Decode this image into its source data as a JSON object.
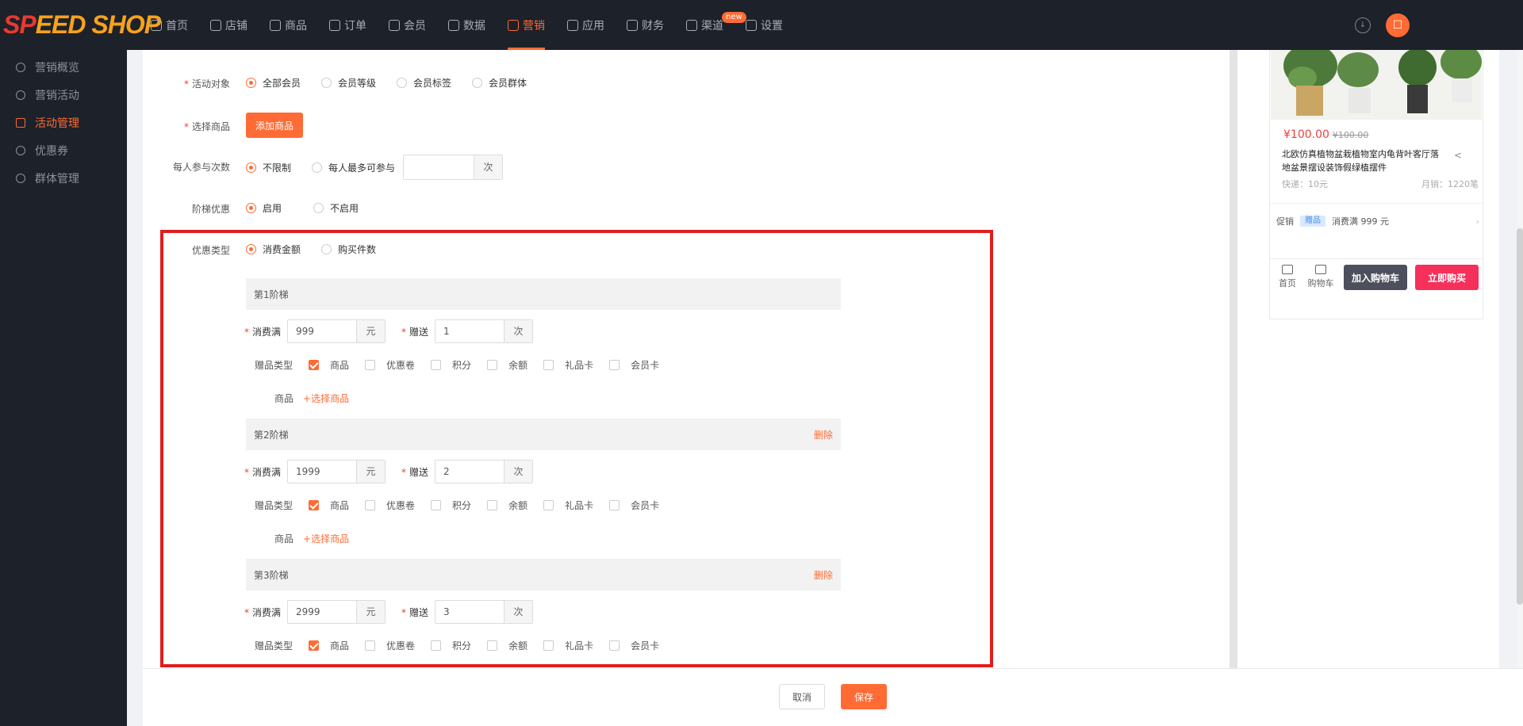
{
  "logo": {
    "part1": "SP",
    "part2": "EED SHOP"
  },
  "nav": [
    {
      "label": "首页",
      "icon": "home-icon"
    },
    {
      "label": "店铺",
      "icon": "store-icon"
    },
    {
      "label": "商品",
      "icon": "product-icon"
    },
    {
      "label": "订单",
      "icon": "order-icon"
    },
    {
      "label": "会员",
      "icon": "member-icon"
    },
    {
      "label": "数据",
      "icon": "chart-icon"
    },
    {
      "label": "营销",
      "icon": "tag-icon",
      "active": true
    },
    {
      "label": "应用",
      "icon": "app-icon"
    },
    {
      "label": "财务",
      "icon": "finance-icon"
    },
    {
      "label": "渠道",
      "icon": "channel-icon",
      "badge": "new"
    },
    {
      "label": "设置",
      "icon": "settings-icon"
    }
  ],
  "sidebar": [
    {
      "label": "营销概览"
    },
    {
      "label": "营销活动"
    },
    {
      "label": "活动管理",
      "active": true
    },
    {
      "label": "优惠券"
    },
    {
      "label": "群体管理"
    }
  ],
  "form": {
    "target_label": "活动对象",
    "target_options": [
      "全部会员",
      "会员等级",
      "会员标签",
      "会员群体"
    ],
    "product_label": "选择商品",
    "add_product_btn": "添加商品",
    "times_label": "每人参与次数",
    "times_options": [
      "不限制",
      "每人最多可参与"
    ],
    "times_value": "",
    "times_suffix": "次",
    "tier_label": "阶梯优惠",
    "tier_options": [
      "启用",
      "不启用"
    ],
    "discount_label": "优惠类型",
    "discount_options": [
      "消费金额",
      "购买件数"
    ]
  },
  "tiers": [
    {
      "title": "第1阶梯",
      "spend_label": "消费满",
      "spend": "999",
      "spend_unit": "元",
      "gift_label": "赠送",
      "gift": "1",
      "gift_unit": "次",
      "type_label": "赠品类型",
      "product_label": "商品",
      "select_link": "+选择商品",
      "delete": ""
    },
    {
      "title": "第2阶梯",
      "spend_label": "消费满",
      "spend": "1999",
      "spend_unit": "元",
      "gift_label": "赠送",
      "gift": "2",
      "gift_unit": "次",
      "type_label": "赠品类型",
      "product_label": "商品",
      "select_link": "+选择商品",
      "delete": "删除"
    },
    {
      "title": "第3阶梯",
      "spend_label": "消费满",
      "spend": "2999",
      "spend_unit": "元",
      "gift_label": "赠送",
      "gift": "3",
      "gift_unit": "次",
      "type_label": "赠品类型",
      "delete": "删除"
    }
  ],
  "gift_types": [
    "商品",
    "优惠卷",
    "积分",
    "余额",
    "礼品卡",
    "会员卡"
  ],
  "footer": {
    "cancel": "取消",
    "save": "保存"
  },
  "preview": {
    "price": "¥100.00",
    "price_old": "¥100.00",
    "title": "北欧仿真植物盆栽植物室内龟背叶客厅落地盆景摆设装饰假绿植摆件",
    "shipping": "快递：10元",
    "sales": "月销：1220笔",
    "promo_label": "促销",
    "promo_badge": "赠品",
    "promo_text": "消费满 999 元",
    "nav_home": "首页",
    "nav_cart": "购物车",
    "add_cart": "加入购物车",
    "buy_now": "立即购买"
  },
  "colors": {
    "accent": "#ff6b35",
    "dark": "#1d2129",
    "highlight": "#e01e1e"
  }
}
